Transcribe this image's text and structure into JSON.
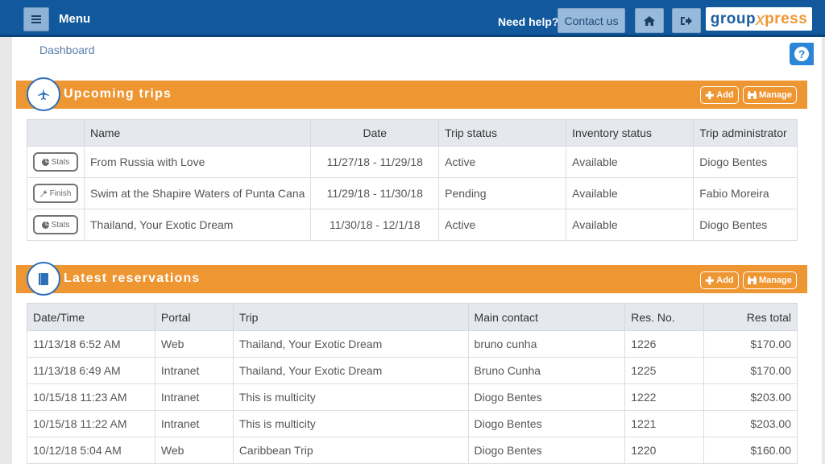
{
  "header": {
    "menu_label": "Menu",
    "need_help": "Need help?",
    "contact_label": "Contact us",
    "logo": {
      "part1": "group",
      "part2": "x",
      "part3": "press"
    }
  },
  "breadcrumb": "Dashboard",
  "upcoming_trips": {
    "title": "Upcoming trips",
    "add_label": "Add",
    "manage_label": "Manage",
    "columns": [
      "",
      "Name",
      "Date",
      "Trip status",
      "Inventory status",
      "Trip administrator"
    ],
    "rows": [
      {
        "action": "Stats",
        "name": "From Russia with Love",
        "date": "11/27/18 - 11/29/18",
        "status": "Active",
        "inventory": "Available",
        "admin": "Diogo Bentes"
      },
      {
        "action": "Finish",
        "name": "Swim at the Shapire Waters of Punta Cana",
        "date": "11/29/18 - 11/30/18",
        "status": "Pending",
        "inventory": "Available",
        "admin": "Fabio Moreira"
      },
      {
        "action": "Stats",
        "name": "Thailand, Your Exotic Dream",
        "date": "11/30/18 - 12/1/18",
        "status": "Active",
        "inventory": "Available",
        "admin": "Diogo Bentes"
      }
    ]
  },
  "latest_reservations": {
    "title": "Latest reservations",
    "add_label": "Add",
    "manage_label": "Manage",
    "columns": [
      "Date/Time",
      "Portal",
      "Trip",
      "Main contact",
      "Res. No.",
      "Res total"
    ],
    "rows": [
      {
        "datetime": "11/13/18 6:52 AM",
        "portal": "Web",
        "trip": "Thailand, Your Exotic Dream",
        "contact": "bruno cunha",
        "res_no": "1226",
        "total": "$170.00"
      },
      {
        "datetime": "11/13/18 6:49 AM",
        "portal": "Intranet",
        "trip": "Thailand, Your Exotic Dream",
        "contact": "Bruno Cunha",
        "res_no": "1225",
        "total": "$170.00"
      },
      {
        "datetime": "10/15/18 11:23 AM",
        "portal": "Intranet",
        "trip": "This is multicity",
        "contact": "Diogo Bentes",
        "res_no": "1222",
        "total": "$203.00"
      },
      {
        "datetime": "10/15/18 11:22 AM",
        "portal": "Intranet",
        "trip": "This is multicity",
        "contact": "Diogo Bentes",
        "res_no": "1221",
        "total": "$203.00"
      },
      {
        "datetime": "10/12/18 5:04 AM",
        "portal": "Web",
        "trip": "Caribbean Trip",
        "contact": "Diogo Bentes",
        "res_no": "1220",
        "total": "$160.00"
      }
    ]
  },
  "colors": {
    "header_blue": "#11589c",
    "section_orange": "#ee9632",
    "help_blue": "#2b86d8",
    "logo_orange": "#ee9632",
    "logo_blue": "#1c5fa3"
  },
  "icons": {
    "menu": "hamburger-icon",
    "home": "home-icon",
    "logout": "sign-out-icon",
    "help": "question-icon",
    "plane": "plane-icon",
    "book": "book-icon",
    "add": "plus-icon",
    "manage": "binoculars-icon",
    "stats": "pie-chart-icon",
    "finish": "wrench-icon"
  }
}
